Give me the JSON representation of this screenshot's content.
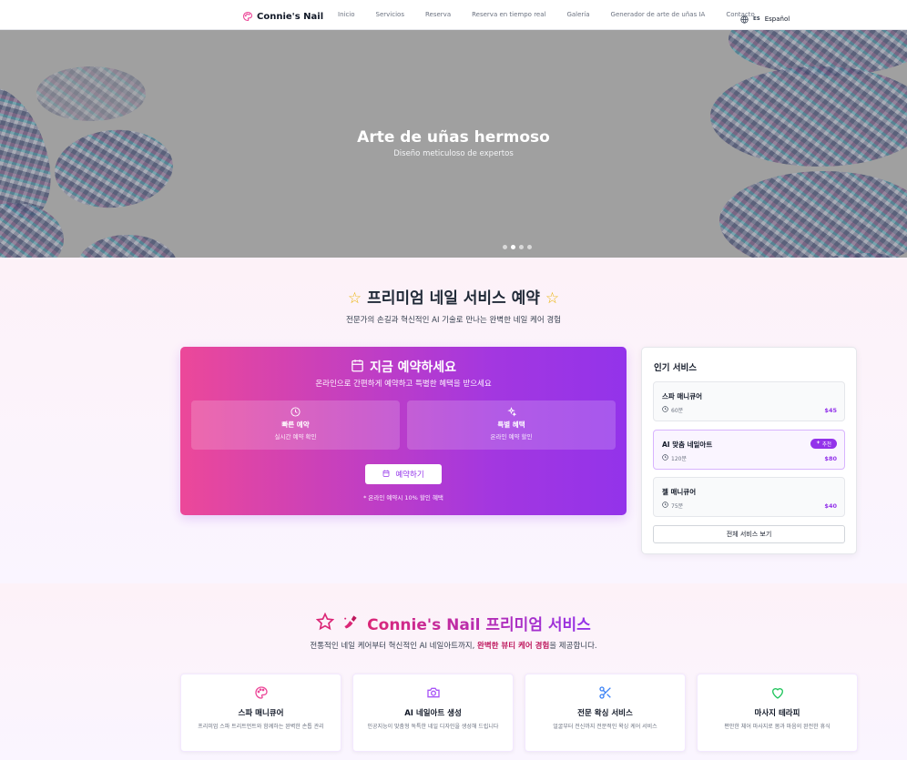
{
  "nav": {
    "brand": "Connie's Nail",
    "links": [
      "Inicio",
      "Servicios",
      "Reserva",
      "Reserva en tiempo real",
      "Galería",
      "Generador de arte de uñas IA",
      "Contacto"
    ],
    "lang_code": "ES",
    "lang_name": "Español"
  },
  "hero": {
    "title": "Arte de uñas hermoso",
    "subtitle": "Diseño meticuloso de expertos",
    "slides": 4,
    "active_slide": 2
  },
  "booking": {
    "section_title": "프리미엄 네일 서비스 예약",
    "section_subtitle": "전문가의 손길과 혁신적인 AI 기술로 만나는 완벽한 네일 케어 경험",
    "card_title": "지금 예약하세요",
    "card_subtitle": "온라인으로 간편하게 예약하고 특별한 혜택을 받으세요",
    "features": [
      {
        "title": "빠른 예약",
        "desc": "실시간 예약 확인"
      },
      {
        "title": "특별 혜택",
        "desc": "온라인 예약 할인"
      }
    ],
    "button": "예약하기",
    "note": "* 온라인 예약시 10% 할인 혜택"
  },
  "popular": {
    "title": "인기 서비스",
    "services": [
      {
        "name": "스파 매니큐어",
        "duration": "60분",
        "price": "$45"
      },
      {
        "name": "AI 맞춤 네일아트",
        "duration": "120분",
        "price": "$80",
        "badge": "추천"
      },
      {
        "name": "젤 매니큐어",
        "duration": "75분",
        "price": "$40"
      }
    ],
    "view_all": "전체 서비스 보기"
  },
  "premium": {
    "title": "Connie's Nail 프리미엄 서비스",
    "subtitle_before": "전통적인 네일 케어부터 혁신적인 AI 네일아트까지,",
    "subtitle_em": "완벽한 뷰티 케어 경험",
    "subtitle_after": "을 제공합니다.",
    "cards": [
      {
        "title": "스파 매니큐어",
        "desc": "프리미엄 스파 트리트먼트와 함께하는 완벽한 손톱 관리",
        "icon": "palette-icon",
        "color": "#ec4899"
      },
      {
        "title": "AI 네일아트 생성",
        "desc": "인공지능이 맞춤형 독특한 네일 디자인을 생성해 드립니다",
        "icon": "camera-icon",
        "color": "#a855f7"
      },
      {
        "title": "전문 왁싱 서비스",
        "desc": "얼굴부터 전신까지 전문적인 왁싱 케어 서비스",
        "icon": "scissors-icon",
        "color": "#3b82f6"
      },
      {
        "title": "마사지 테라피",
        "desc": "편안한 체어 마사지로 몸과 마음의 완전한 휴식",
        "icon": "heart-icon",
        "color": "#22c55e"
      }
    ]
  },
  "colors": {
    "pink": "#ec4899",
    "purple": "#9333ea",
    "star": "#eab308"
  }
}
